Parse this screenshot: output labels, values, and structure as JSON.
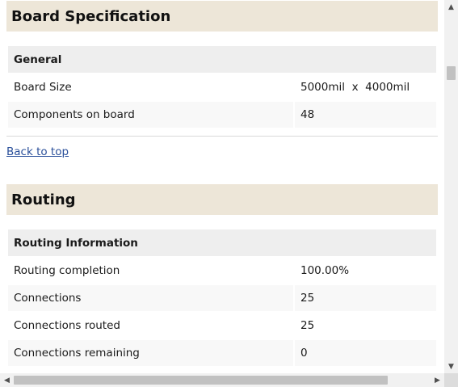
{
  "board_spec": {
    "title": "Board Specification",
    "group": "General",
    "rows": [
      {
        "label": "Board Size",
        "value": "5000mil  x  4000mil"
      },
      {
        "label": "Components on board",
        "value": "48"
      }
    ],
    "back_link": "Back to top"
  },
  "routing": {
    "title": "Routing",
    "group": "Routing Information",
    "rows": [
      {
        "label": "Routing completion",
        "value": "100.00%"
      },
      {
        "label": "Connections",
        "value": "25"
      },
      {
        "label": "Connections routed",
        "value": "25"
      },
      {
        "label": "Connections remaining",
        "value": "0"
      }
    ]
  },
  "scrollbars": {
    "up_icon": "▲",
    "down_icon": "▼",
    "left_icon": "◀",
    "right_icon": "▶"
  }
}
